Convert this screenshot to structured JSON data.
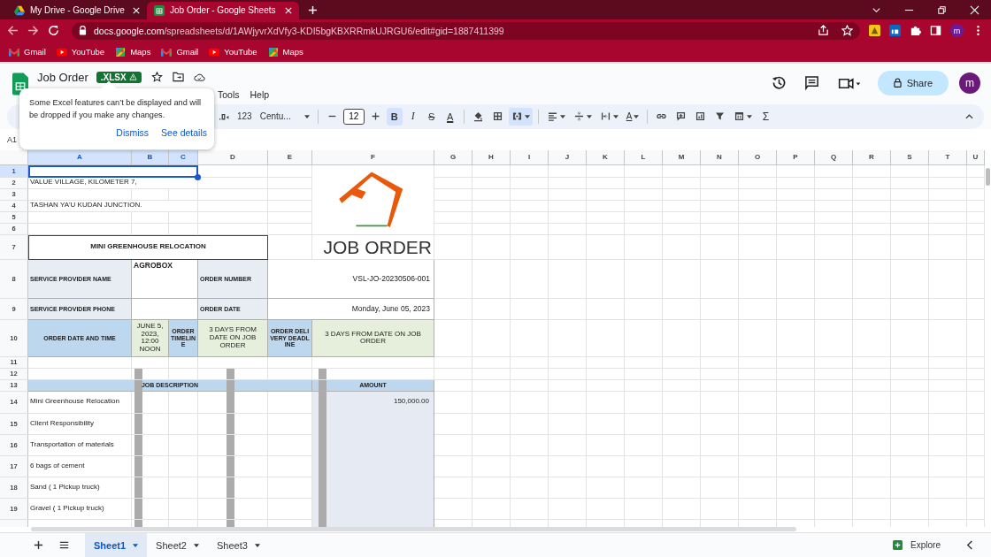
{
  "browser": {
    "tabs": [
      {
        "title": "My Drive - Google Drive",
        "selected": false
      },
      {
        "title": "Job Order - Google Sheets",
        "selected": true
      }
    ],
    "url": {
      "host": "docs.google.com",
      "path": "/spreadsheets/d/1AWjyvrXdVfy3-KDI5bgKBXRRmkUJRGU6/edit#gid=1887411399"
    },
    "profile": "m",
    "bookmarks": [
      "Gmail",
      "YouTube",
      "Maps",
      "Gmail",
      "YouTube",
      "Maps"
    ]
  },
  "doc": {
    "title": "Job Order",
    "badge": ".XLSX",
    "menu": [
      "Tools",
      "Help"
    ],
    "share": "Share",
    "avatar": "m",
    "name_box": "A1"
  },
  "popover": {
    "message": "Some Excel features can’t be displayed and will be dropped if you make any changes.",
    "actions": [
      "Dismiss",
      "See details"
    ]
  },
  "toolbar": [
    {
      "kind": "decimal"
    },
    {
      "kind": "format",
      "label": "123"
    },
    {
      "kind": "font",
      "label": "Centu..."
    },
    {
      "kind": "minus"
    },
    {
      "kind": "size",
      "label": "12"
    },
    {
      "kind": "plus"
    },
    {
      "kind": "bold",
      "label": "B",
      "selected": true
    },
    {
      "kind": "italic",
      "label": "I",
      "selected": false
    },
    {
      "kind": "strike",
      "label": "S",
      "selected": false
    },
    {
      "kind": "color",
      "label": "A"
    },
    {
      "kind": "fill"
    },
    {
      "kind": "borders"
    },
    {
      "kind": "merge",
      "selected": true
    },
    {
      "kind": "align"
    },
    {
      "kind": "valign"
    },
    {
      "kind": "wrap"
    },
    {
      "kind": "rotate",
      "label": "A"
    },
    {
      "kind": "link"
    },
    {
      "kind": "comment"
    },
    {
      "kind": "chart"
    },
    {
      "kind": "filter"
    },
    {
      "kind": "views"
    },
    {
      "kind": "functions",
      "label": "Σ"
    }
  ],
  "sheet": {
    "columns": [
      {
        "label": "A",
        "selected": true
      },
      {
        "label": "B",
        "selected": true
      },
      {
        "label": "C",
        "selected": true
      },
      {
        "label": "D",
        "selected": false
      },
      {
        "label": "E",
        "selected": false
      },
      {
        "label": "F",
        "selected": false
      },
      {
        "label": "G",
        "selected": false
      },
      {
        "label": "H",
        "selected": false
      },
      {
        "label": "I",
        "selected": false
      },
      {
        "label": "J",
        "selected": false
      },
      {
        "label": "K",
        "selected": false
      },
      {
        "label": "L",
        "selected": false
      },
      {
        "label": "M",
        "selected": false
      },
      {
        "label": "N",
        "selected": false
      },
      {
        "label": "O",
        "selected": false
      },
      {
        "label": "P",
        "selected": false
      },
      {
        "label": "Q",
        "selected": false
      },
      {
        "label": "R",
        "selected": false
      },
      {
        "label": "S",
        "selected": false
      },
      {
        "label": "T",
        "selected": false
      },
      {
        "label": "U",
        "selected": false
      }
    ],
    "rows": [
      {
        "label": "1",
        "selected": true
      },
      {
        "label": "2",
        "selected": false
      },
      {
        "label": "3",
        "selected": false
      },
      {
        "label": "4",
        "selected": false
      },
      {
        "label": "5",
        "selected": false
      },
      {
        "label": "6",
        "selected": false
      },
      {
        "label": "7",
        "selected": false
      },
      {
        "label": "8",
        "selected": false
      },
      {
        "label": "9",
        "selected": false
      },
      {
        "label": "10",
        "selected": false
      },
      {
        "label": "11",
        "selected": false
      },
      {
        "label": "12",
        "selected": false
      },
      {
        "label": "13",
        "selected": false
      },
      {
        "label": "14",
        "selected": false
      },
      {
        "label": "15",
        "selected": false
      },
      {
        "label": "16",
        "selected": false
      },
      {
        "label": "17",
        "selected": false
      },
      {
        "label": "18",
        "selected": false
      },
      {
        "label": "19",
        "selected": false
      }
    ],
    "cells": [
      {
        "kind": "item",
        "selected": true
      },
      {
        "kind": "item",
        "text": "VALUE VILLAGE, KILOMETER 7,",
        "selected": false
      },
      {
        "kind": "item",
        "text": "TASHAN YA'U KUDAN JUNCTION.",
        "selected": false
      },
      {
        "kind": "logo",
        "selected": false
      },
      {
        "kind": "title",
        "text": "MINI GREENHOUSE RELOCATION",
        "selected": false
      },
      {
        "kind": "big",
        "text": "JOB ORDER",
        "selected": false
      },
      {
        "kind": "label",
        "text": "SERVICE PROVIDER NAME",
        "selected": false
      },
      {
        "kind": "top",
        "text": "AGROBOX",
        "selected": false
      },
      {
        "kind": "label",
        "text": "ORDER NUMBER",
        "selected": false
      },
      {
        "kind": "value",
        "text": "VSL-JO-20230506-001",
        "selected": false
      },
      {
        "kind": "label",
        "text": "SERVICE PROVIDER PHONE",
        "selected": false
      },
      {
        "kind": "value",
        "selected": false
      },
      {
        "kind": "label",
        "text": "ORDER DATE",
        "selected": false
      },
      {
        "kind": "value",
        "text": "Monday, June 05, 2023",
        "selected": false
      },
      {
        "kind": "header",
        "text": "ORDER DATE AND TIME",
        "selected": false
      },
      {
        "kind": "green",
        "text": "JUNE 5, 2023, 12:00 NOON",
        "selected": false
      },
      {
        "kind": "header",
        "text": "ORDER TIMELINE",
        "selected": false
      },
      {
        "kind": "green",
        "text": "3 DAYS FROM DATE ON JOB ORDER",
        "selected": false
      },
      {
        "kind": "header",
        "text": "ORDER DELIVERY DEADLINE",
        "selected": false
      },
      {
        "kind": "green",
        "text": "3 DAYS FROM DATE ON JOB ORDER",
        "selected": false
      },
      {
        "kind": "header",
        "text": "JOB DESCRIPTION",
        "selected": false
      },
      {
        "kind": "header",
        "text": "AMOUNT",
        "selected": false
      },
      {
        "kind": "item",
        "text": "Mini Greenhouse Relocation",
        "selected": false
      },
      {
        "kind": "amount",
        "text": "150,000.00",
        "selected": false
      },
      {
        "kind": "item",
        "text": "Client Responsibility",
        "selected": false
      },
      {
        "kind": "item",
        "text": "Transportation of materials",
        "selected": false
      },
      {
        "kind": "item",
        "text": "6 bags of cement",
        "selected": false
      },
      {
        "kind": "item",
        "text": "Sand ( 1 Pickup truck)",
        "selected": false
      },
      {
        "kind": "item",
        "text": "Gravel ( 1 Pickup truck)",
        "selected": false
      }
    ]
  },
  "sheet_tabs": [
    {
      "label": "Sheet1",
      "selected": true
    },
    {
      "label": "Sheet2",
      "selected": false
    },
    {
      "label": "Sheet3",
      "selected": false
    }
  ],
  "explore": "Explore"
}
